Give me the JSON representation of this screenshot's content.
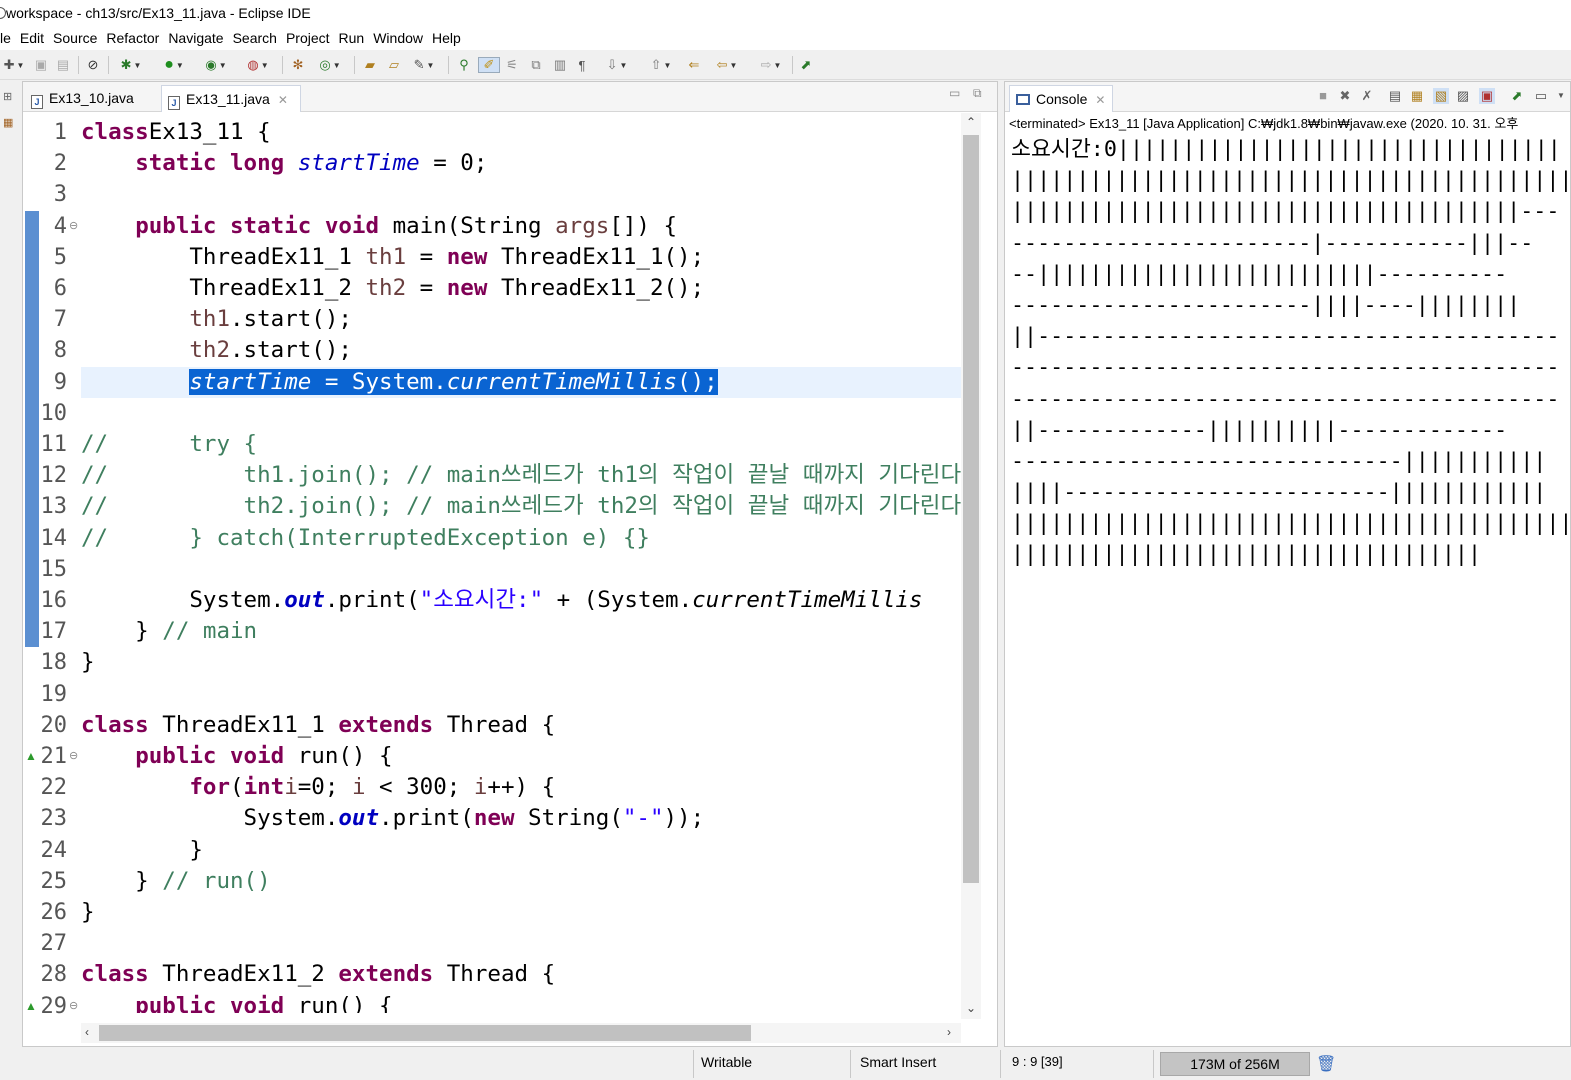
{
  "window": {
    "title": "workspace - ch13/src/Ex13_11.java - Eclipse IDE"
  },
  "menu": [
    "le",
    "Edit",
    "Source",
    "Refactor",
    "Navigate",
    "Search",
    "Project",
    "Run",
    "Window",
    "Help"
  ],
  "editor": {
    "tabs": [
      {
        "label": "Ex13_10.java",
        "active": false
      },
      {
        "label": "Ex13_11.java",
        "active": true
      }
    ],
    "lines": [
      {
        "n": "1",
        "segs": [
          [
            "kw",
            "class"
          ],
          [
            "",
            "Ex13_11 {"
          ]
        ]
      },
      {
        "n": "2",
        "segs": [
          [
            "",
            "    "
          ],
          [
            "kw",
            "static long"
          ],
          [
            "",
            " "
          ],
          [
            "fld",
            "startTime"
          ],
          [
            "",
            " = 0;"
          ]
        ]
      },
      {
        "n": "3",
        "segs": []
      },
      {
        "n": "4",
        "segs": [
          [
            "",
            "    "
          ],
          [
            "kw",
            "public static void"
          ],
          [
            "",
            " main(String "
          ],
          [
            "var",
            "args"
          ],
          [
            "",
            "[]) {"
          ]
        ],
        "fold": "⊖"
      },
      {
        "n": "5",
        "segs": [
          [
            "",
            "        ThreadEx11_1 "
          ],
          [
            "var",
            "th1"
          ],
          [
            "",
            " = "
          ],
          [
            "kw",
            "new"
          ],
          [
            "",
            " ThreadEx11_1();"
          ]
        ]
      },
      {
        "n": "6",
        "segs": [
          [
            "",
            "        ThreadEx11_2 "
          ],
          [
            "var",
            "th2"
          ],
          [
            "",
            " = "
          ],
          [
            "kw",
            "new"
          ],
          [
            "",
            " ThreadEx11_2();"
          ]
        ]
      },
      {
        "n": "7",
        "segs": [
          [
            "",
            "        "
          ],
          [
            "var",
            "th1"
          ],
          [
            "",
            ".start();"
          ]
        ]
      },
      {
        "n": "8",
        "segs": [
          [
            "",
            "        "
          ],
          [
            "var",
            "th2"
          ],
          [
            "",
            ".start();"
          ]
        ]
      },
      {
        "n": "9",
        "segs": [
          [
            "",
            "        "
          ],
          [
            "selfld",
            "startTime"
          ],
          [
            "sel",
            " = System."
          ],
          [
            "selsm",
            "currentTimeMillis"
          ],
          [
            "sel",
            "();"
          ]
        ]
      },
      {
        "n": "10",
        "segs": []
      },
      {
        "n": "11",
        "segs": [
          [
            "cm",
            "//      try {"
          ]
        ]
      },
      {
        "n": "12",
        "segs": [
          [
            "cm",
            "//          th1.join(); // main쓰레드가 th1의 작업이 끝날 때까지 기다린다"
          ]
        ]
      },
      {
        "n": "13",
        "segs": [
          [
            "cm",
            "//          th2.join(); // main쓰레드가 th2의 작업이 끝날 때까지 기다린다"
          ]
        ]
      },
      {
        "n": "14",
        "segs": [
          [
            "cm",
            "//      } catch(InterruptedException e) {}"
          ]
        ]
      },
      {
        "n": "15",
        "segs": []
      },
      {
        "n": "16",
        "segs": [
          [
            "",
            "        System."
          ],
          [
            "fldb",
            "out"
          ],
          [
            "",
            ".print("
          ],
          [
            "str",
            "\"소요시간:\""
          ],
          [
            "",
            " + (System."
          ],
          [
            "sm",
            "currentTimeMillis"
          ]
        ]
      },
      {
        "n": "17",
        "segs": [
          [
            "",
            "    } "
          ],
          [
            "cm",
            "// main"
          ]
        ]
      },
      {
        "n": "18",
        "segs": [
          [
            "",
            "}"
          ]
        ]
      },
      {
        "n": "19",
        "segs": []
      },
      {
        "n": "20",
        "segs": [
          [
            "kw",
            "class"
          ],
          [
            "",
            " ThreadEx11_1 "
          ],
          [
            "kw",
            "extends"
          ],
          [
            "",
            " Thread {"
          ]
        ]
      },
      {
        "n": "21",
        "segs": [
          [
            "",
            "    "
          ],
          [
            "kw",
            "public void"
          ],
          [
            "",
            " run() {"
          ]
        ],
        "fold": "⊖",
        "ovr": true
      },
      {
        "n": "22",
        "segs": [
          [
            "",
            "        "
          ],
          [
            "kw",
            "for"
          ],
          [
            "",
            "("
          ],
          [
            "kw",
            "int"
          ],
          [
            "",
            "",
            " "
          ],
          [
            "var",
            "i"
          ],
          [
            "",
            "=0; "
          ],
          [
            "var",
            "i"
          ],
          [
            "",
            " < 300; "
          ],
          [
            "var",
            "i"
          ],
          [
            "",
            "++) {"
          ]
        ]
      },
      {
        "n": "23",
        "segs": [
          [
            "",
            "            System."
          ],
          [
            "fldb",
            "out"
          ],
          [
            "",
            ".print("
          ],
          [
            "kw",
            "new"
          ],
          [
            "",
            " String("
          ],
          [
            "str",
            "\"-\""
          ],
          [
            "",
            "));"
          ]
        ]
      },
      {
        "n": "24",
        "segs": [
          [
            "",
            "        }"
          ]
        ]
      },
      {
        "n": "25",
        "segs": [
          [
            "",
            "    } "
          ],
          [
            "cm",
            "// run()"
          ]
        ]
      },
      {
        "n": "26",
        "segs": [
          [
            "",
            "}"
          ]
        ]
      },
      {
        "n": "27",
        "segs": []
      },
      {
        "n": "28",
        "segs": [
          [
            "kw",
            "class"
          ],
          [
            "",
            " ThreadEx11_2 "
          ],
          [
            "kw",
            "extends"
          ],
          [
            "",
            " Thread {"
          ]
        ]
      },
      {
        "n": "29",
        "segs": [
          [
            "",
            "    "
          ],
          [
            "kw",
            "public void"
          ],
          [
            "",
            " run() {"
          ]
        ],
        "fold": "⊖",
        "ovr": true
      }
    ]
  },
  "console": {
    "tab_label": "Console",
    "header": "<terminated> Ex13_11 [Java Application] C:₩jdk1.8₩bin₩javaw.exe (2020. 10. 31. 오후",
    "output": [
      "소요시간:0||||||||||||||||||||||||||||||||||",
      "||||||||||||||||||||||||||||||||||||||||||||",
      "|||||||||||||||||||||||||||||||||||||||---",
      "-----------------------|-----------|||--",
      "--||||||||||||||||||||||||||----------",
      "-----------------------||||----||||||||",
      "||----------------------------------------",
      "------------------------------------------",
      "------------------------------------------",
      "||-------------||||||||||-------------",
      "------------------------------|||||||||||",
      "||||-------------------------||||||||||||",
      "||||||||||||||||||||||||||||||||||||||||||||",
      "||||||||||||||||||||||||||||||||||||"
    ]
  },
  "status": {
    "writable": "Writable",
    "insert_mode": "Smart Insert",
    "position": "9 : 9 [39]",
    "heap": "173M of 256M"
  },
  "colors": {
    "keyword": "#7f0055",
    "field": "#0000c0",
    "comment": "#3f7f5f",
    "string": "#2a00ff",
    "selection": "#0a64d2",
    "current_line": "#e8f2fe"
  }
}
